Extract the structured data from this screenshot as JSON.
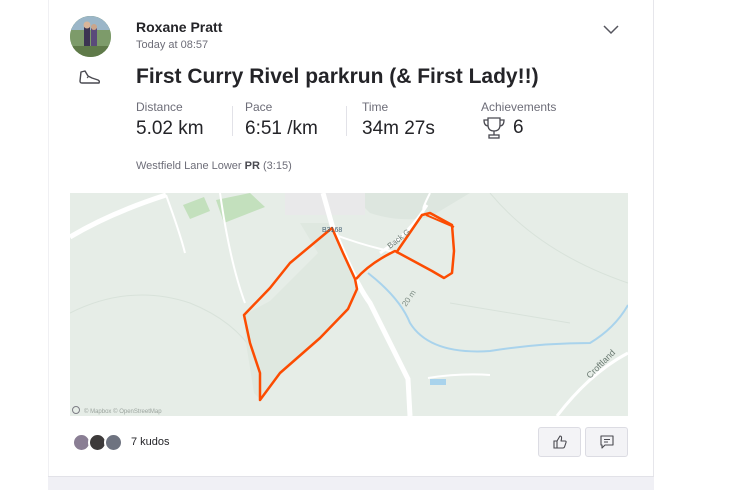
{
  "athlete": {
    "name": "Roxane Pratt",
    "timestamp": "Today at 08:57"
  },
  "activity": {
    "title": "First Curry Rivel parkrun (& First Lady!!)",
    "sport_icon": "running-shoe-icon",
    "stats": [
      {
        "label": "Distance",
        "value": "5.02 km"
      },
      {
        "label": "Pace",
        "value": "6:51 /km"
      },
      {
        "label": "Time",
        "value": "34m 27s"
      }
    ],
    "achievements": {
      "label": "Achievements",
      "count": "6",
      "icon": "trophy-icon"
    },
    "segment": {
      "name": "Westfield Lane Lower",
      "badge": "PR",
      "time": "(3:15)"
    }
  },
  "map": {
    "road_labels": [
      "B3168",
      "Back G",
      "Croftland"
    ],
    "contour_label": "20 m",
    "route_color": "#fc4c02",
    "attribution": "© Mapbox © OpenStreetMap"
  },
  "kudos": {
    "text": "7 kudos"
  },
  "actions": {
    "kudos_button_icon": "thumbs-up-icon",
    "comment_button_icon": "comment-icon"
  }
}
